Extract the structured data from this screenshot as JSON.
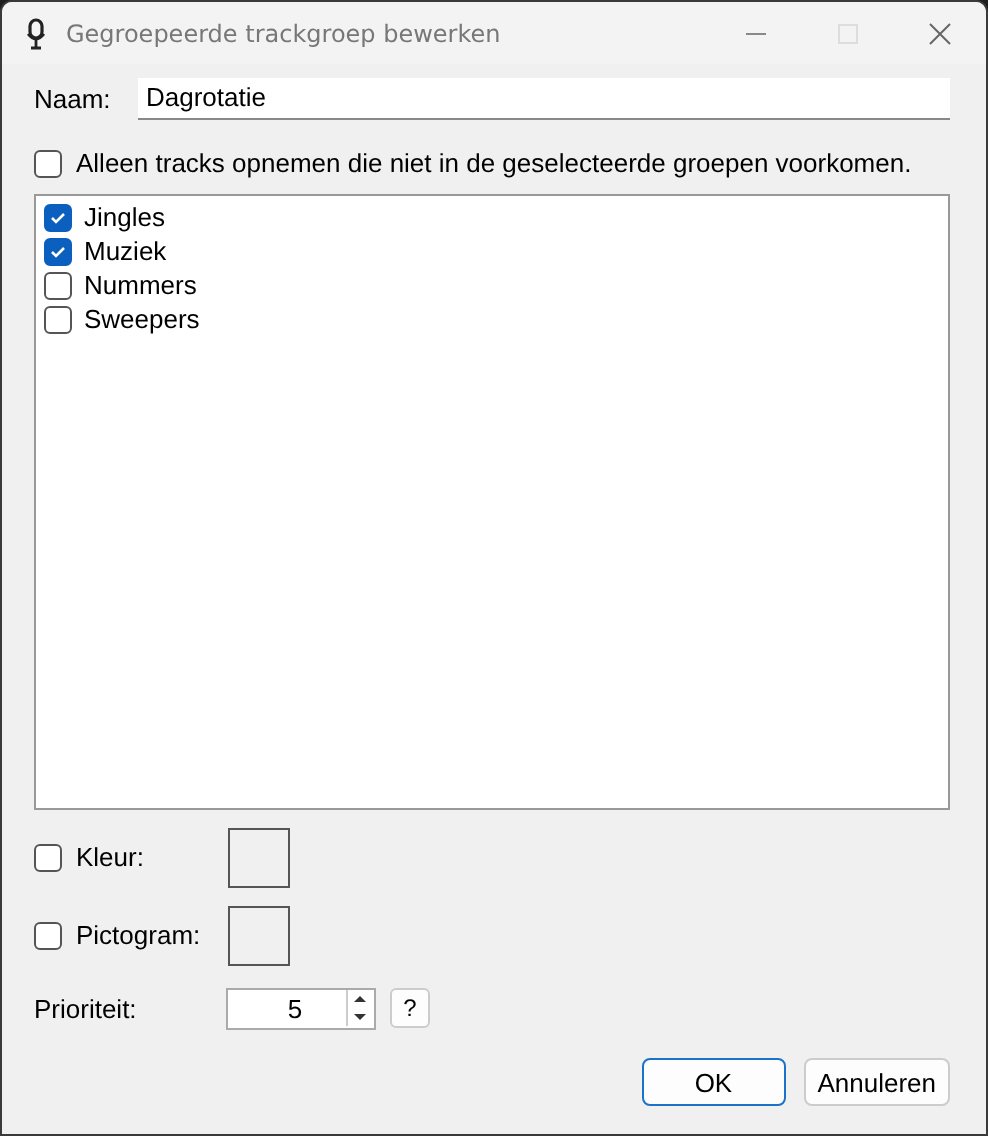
{
  "window": {
    "title": "Gegroepeerde trackgroep bewerken"
  },
  "name": {
    "label": "Naam:",
    "value": "Dagrotatie"
  },
  "exclude": {
    "label": "Alleen tracks opnemen die niet in de geselecteerde groepen voorkomen.",
    "checked": false
  },
  "groups": [
    {
      "label": "Jingles",
      "checked": true
    },
    {
      "label": "Muziek",
      "checked": true
    },
    {
      "label": "Nummers",
      "checked": false
    },
    {
      "label": "Sweepers",
      "checked": false
    }
  ],
  "color": {
    "label": "Kleur:",
    "checked": false
  },
  "icon": {
    "label": "Pictogram:",
    "checked": false
  },
  "priority": {
    "label": "Prioriteit:",
    "value": "5",
    "help": "?"
  },
  "buttons": [
    {
      "label": "OK",
      "kind": "default"
    },
    {
      "label": "Annuleren",
      "kind": "normal"
    }
  ]
}
